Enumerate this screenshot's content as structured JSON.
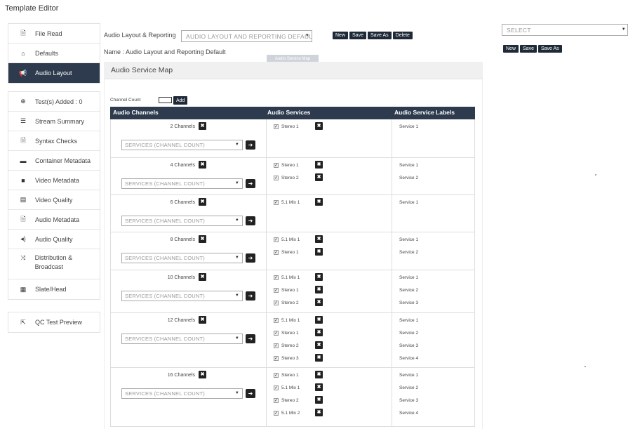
{
  "page_title": "Template Editor",
  "sidebar": {
    "group1": [
      {
        "label": "File Read",
        "icon": "file-icon",
        "glyph": "🗎"
      },
      {
        "label": "Defaults",
        "icon": "home-icon",
        "glyph": "⌂"
      },
      {
        "label": "Audio Layout",
        "icon": "megaphone-icon",
        "glyph": "📢",
        "active": true
      }
    ],
    "group2": [
      {
        "label": "Test(s) Added : 0",
        "icon": "plus-circle-icon",
        "glyph": "⊕"
      },
      {
        "label": "Stream Summary",
        "icon": "list-icon",
        "glyph": "☰"
      },
      {
        "label": "Syntax Checks",
        "icon": "document-icon",
        "glyph": "🗎"
      },
      {
        "label": "Container Metadata",
        "icon": "folder-icon",
        "glyph": "▬"
      },
      {
        "label": "Video Metadata",
        "icon": "video-camera-icon",
        "glyph": "■"
      },
      {
        "label": "Video Quality",
        "icon": "film-icon",
        "glyph": "▤"
      },
      {
        "label": "Audio Metadata",
        "icon": "audio-file-icon",
        "glyph": "🗎"
      },
      {
        "label": "Audio Quality",
        "icon": "volume-icon",
        "glyph": "◂)"
      },
      {
        "label": "Distribution & Broadcast",
        "icon": "shuffle-icon",
        "glyph": "⤨"
      },
      {
        "label": "Slate/Head",
        "icon": "grid-icon",
        "glyph": "▦"
      }
    ],
    "group3": [
      {
        "label": "QC Test Preview",
        "icon": "external-link-icon",
        "glyph": "⇱"
      }
    ]
  },
  "top": {
    "layout_label": "Audio Layout & Reporting",
    "layout_select_value": "AUDIO LAYOUT AND REPORTING DEFAULT",
    "name_line": "Name : Audio Layout and Reporting Default",
    "buttons": {
      "new": "New",
      "save": "Save",
      "save_as": "Save As",
      "delete": "Delete"
    }
  },
  "right": {
    "select_placeholder": "SELECT",
    "buttons": {
      "new": "New",
      "save": "Save",
      "save_as": "Save As"
    }
  },
  "tooltip": "Audio Service Map",
  "panel": {
    "title": "Audio Service Map",
    "channel_count_label": "Channel Count",
    "add_label": "Add",
    "columns": [
      "Audio Channels",
      "Audio Services",
      "Audio Service Labels"
    ],
    "services_placeholder": "SERVICES (CHANNEL COUNT)",
    "groups": [
      {
        "channels": "2 Channels",
        "services": [
          "Stereo 1"
        ],
        "labels": [
          "Service 1"
        ]
      },
      {
        "channels": "4 Channels",
        "services": [
          "Stereo 1",
          "Stereo 2"
        ],
        "labels": [
          "Service 1",
          "Service 2"
        ]
      },
      {
        "channels": "6 Channels",
        "services": [
          "5.1 Mix 1"
        ],
        "labels": [
          "Service 1"
        ]
      },
      {
        "channels": "8 Channels",
        "services": [
          "5.1 Mix 1",
          "Stereo 1"
        ],
        "labels": [
          "Service 1",
          "Service 2"
        ]
      },
      {
        "channels": "10 Channels",
        "services": [
          "5.1 Mix 1",
          "Stereo 1",
          "Stereo 2"
        ],
        "labels": [
          "Service 1",
          "Service 2",
          "Service 3"
        ]
      },
      {
        "channels": "12 Channels",
        "services": [
          "5.1 Mix 1",
          "Stereo 1",
          "Stereo 2",
          "Stereo 3"
        ],
        "labels": [
          "Service 1",
          "Service 2",
          "Service 3",
          "Service 4"
        ]
      },
      {
        "channels": "16 Channels",
        "services": [
          "Stereo 1",
          "5.1 Mix 1",
          "Stereo 2",
          "5.1 Mix 2"
        ],
        "labels": [
          "Service 1",
          "Service 2",
          "Service 3",
          "Service 4"
        ]
      }
    ]
  }
}
